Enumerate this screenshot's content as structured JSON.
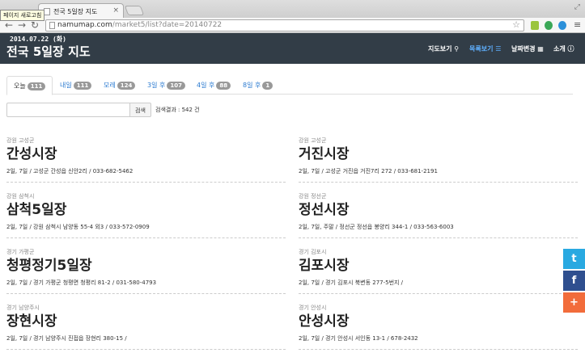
{
  "browser": {
    "tooltip": "페이지 새로고침",
    "tab_title": "전국 5일장 지도",
    "url_host": "namumap.com",
    "url_path": "/market5/list?date=20140722"
  },
  "header": {
    "date": "2014.07.22 (화)",
    "title": "전국 5일장 지도",
    "nav": [
      {
        "label": "지도보기",
        "icon": "map-marker-icon",
        "active": false
      },
      {
        "label": "목록보기",
        "icon": "list-icon",
        "active": true
      },
      {
        "label": "날짜변경",
        "icon": "calendar-icon",
        "active": false
      },
      {
        "label": "소개",
        "icon": "info-icon",
        "active": false
      }
    ]
  },
  "tabs": [
    {
      "label": "오늘",
      "count": "111",
      "active": true
    },
    {
      "label": "내일",
      "count": "111",
      "active": false
    },
    {
      "label": "모레",
      "count": "124",
      "active": false
    },
    {
      "label": "3일 후",
      "count": "107",
      "active": false
    },
    {
      "label": "4일 후",
      "count": "88",
      "active": false
    },
    {
      "label": "8일 후",
      "count": "1",
      "active": false
    }
  ],
  "search": {
    "placeholder": "",
    "button_label": "검색",
    "result_text": "검색결과 : 542 건"
  },
  "markets": [
    {
      "region": "강원 고성군",
      "name": "간성시장",
      "info": "2일, 7일 / 고성군 간성읍 신안2리 / 033-682-5462"
    },
    {
      "region": "강원 고성군",
      "name": "거진시장",
      "info": "2일, 7일 / 고성군 거진읍 거진7리 272 / 033-681-2191"
    },
    {
      "region": "강원 삼척시",
      "name": "삼척5일장",
      "info": "2일, 7일 / 강원 삼척시 남양동 55-4 외3 / 033-572-0909"
    },
    {
      "region": "강원 정선군",
      "name": "정선시장",
      "info": "2일, 7일, 주말 / 정선군 정선읍 봉양리 344-1 / 033-563-6003"
    },
    {
      "region": "경기 가평군",
      "name": "청평정기5일장",
      "info": "2일, 7일 / 경기 가평군 청평면 청평리 81-2 / 031-580-4793"
    },
    {
      "region": "경기 김포시",
      "name": "김포시장",
      "info": "2일, 7일 / 경기 김포시 북변동 277-5번지 /"
    },
    {
      "region": "경기 남양주시",
      "name": "장현시장",
      "info": "2일, 7일 / 경기 남양주시 진접읍 장현리 380-15 /"
    },
    {
      "region": "경기 안성시",
      "name": "안성시장",
      "info": "2일, 7일 / 경기 안성시 서인동 13-1 / 678-2432"
    }
  ],
  "social": [
    {
      "icon": "twitter-icon",
      "glyph": "t",
      "color": "#29a9e1"
    },
    {
      "icon": "facebook-icon",
      "glyph": "f",
      "color": "#2f4f8f"
    },
    {
      "icon": "plus-icon",
      "glyph": "+",
      "color": "#f26c3b"
    }
  ]
}
